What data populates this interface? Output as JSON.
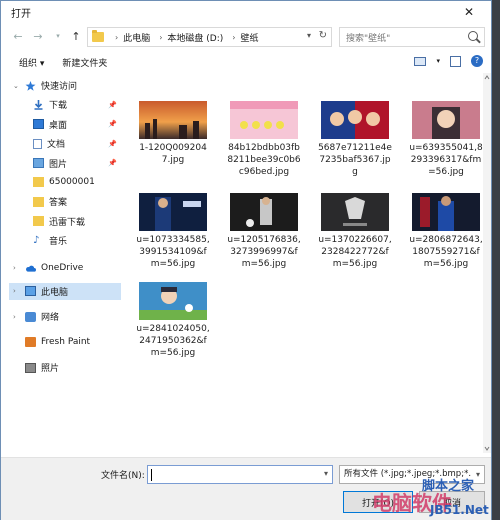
{
  "window": {
    "title": "打开",
    "close_glyph": "✕"
  },
  "address": {
    "crumbs": [
      "此电脑",
      "本地磁盘 (D:)",
      "壁纸"
    ]
  },
  "search": {
    "placeholder": "搜索\"壁纸\""
  },
  "toolbar": {
    "organize": "组织 ▾",
    "new_folder": "新建文件夹"
  },
  "sidebar": {
    "quick_access": "快速访问",
    "items": [
      {
        "label": "下载",
        "pinned": true,
        "icon": "download-icon"
      },
      {
        "label": "桌面",
        "pinned": true,
        "icon": "desktop-icon"
      },
      {
        "label": "文档",
        "pinned": true,
        "icon": "document-icon"
      },
      {
        "label": "图片",
        "pinned": true,
        "icon": "pictures-icon"
      },
      {
        "label": "65000001",
        "pinned": false,
        "icon": "folder-icon"
      },
      {
        "label": "答案",
        "pinned": false,
        "icon": "folder-icon"
      },
      {
        "label": "迅雷下载",
        "pinned": false,
        "icon": "folder-icon"
      },
      {
        "label": "音乐",
        "pinned": false,
        "icon": "music-icon"
      }
    ],
    "onedrive": "OneDrive",
    "this_pc": "此电脑",
    "network": "网络",
    "freshpaint": "Fresh Paint",
    "photos": "照片"
  },
  "files": [
    {
      "name": "1-120Q0092047.jpg"
    },
    {
      "name": "84b12bdbb03fb8211bee39c0b6c96bed.jpg"
    },
    {
      "name": "5687e71211e4e7235baf5367.jpg"
    },
    {
      "name": "u=639355041,8293396317&fm=56.jpg"
    },
    {
      "name": "u=1073334585,3991534109&fm=56.jpg"
    },
    {
      "name": "u=1205176836,3273996997&fm=56.jpg"
    },
    {
      "name": "u=1370226607,2328422772&fm=56.jpg"
    },
    {
      "name": "u=2806872643,1807559271&fm=56.jpg"
    },
    {
      "name": "u=2841024050,2471950362&fm=56.jpg"
    }
  ],
  "bottom": {
    "filename_label": "文件名(N):",
    "filename_value": "",
    "filetype": "所有文件 (*.jpg;*.jpeg;*.bmp;*.",
    "open_button": "打开(O)",
    "cancel_button": "取消"
  },
  "watermark": {
    "line1": "脚本之家",
    "line2": "JB51.Net",
    "line3": "电脑软件"
  },
  "colors": {
    "accent": "#0078d7",
    "selection": "#cde2f7"
  }
}
